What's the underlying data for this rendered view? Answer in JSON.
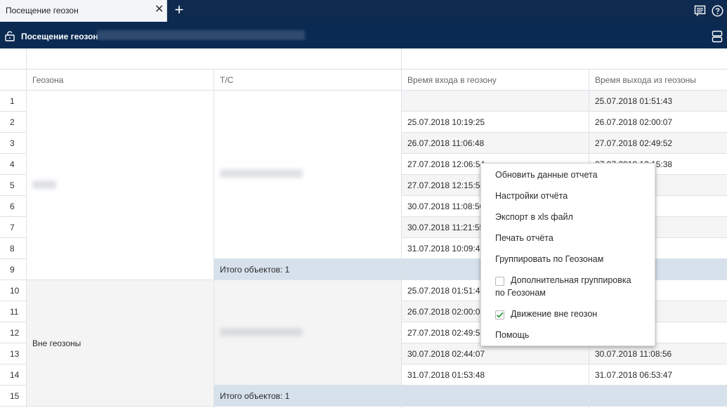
{
  "tabbar": {
    "tab_title": "Посещение геозон",
    "close_glyph": "✕",
    "add_glyph": "+",
    "icons": [
      "chat-icon",
      "help-icon"
    ]
  },
  "report": {
    "title": "Посещение геозон"
  },
  "table": {
    "headers": [
      "Геозона",
      "Т/С",
      "Время входа в геозону",
      "Время выхода из геозоны"
    ],
    "row_numbers": [
      "1",
      "2",
      "3",
      "4",
      "5",
      "6",
      "7",
      "8",
      "9",
      "10",
      "11",
      "12",
      "13",
      "14",
      "15"
    ],
    "entries": [
      "",
      "25.07.2018 10:19:25",
      "26.07.2018 11:06:48",
      "27.07.2018 12:06:54",
      "27.07.2018 12:15:54",
      "30.07.2018 11:08:56",
      "30.07.2018 11:21:55",
      "31.07.2018 10:09:41",
      "",
      "25.07.2018 01:51:43",
      "26.07.2018 02:00:07",
      "27.07.2018 02:49:52",
      "30.07.2018 02:44:07",
      "31.07.2018 01:53:48",
      ""
    ],
    "exits": [
      "25.07.2018 01:51:43",
      "26.07.2018 02:00:07",
      "27.07.2018 02:49:52",
      "27.07.2018 12:15:38",
      "…4:07",
      "…1:18",
      "…3:48",
      "",
      "",
      "…9:25",
      "…6:48",
      "…5:54",
      "30.07.2018 11:08:56",
      "31.07.2018 06:53:47",
      ""
    ],
    "group2_label": "Вне геозоны",
    "total1": "Итого объектов: 1",
    "total2": "Итого объектов: 1"
  },
  "context_menu": {
    "refresh": "Обновить данные отчета",
    "settings": "Настройки отчёта",
    "export": "Экспорт в xls файл",
    "print": "Печать отчёта",
    "group_by": "Группировать по Геозонам",
    "extra_group_line1": "Дополнительная группировка",
    "extra_group_line2": "по Геозонам",
    "extra_group_checked": false,
    "outside_move": "Движение вне геозон",
    "outside_move_checked": true,
    "help": "Помощь"
  },
  "colors": {
    "navy": "#0a2a52",
    "total_row": "#d6e1ec",
    "check_green": "#2e9e3e"
  }
}
